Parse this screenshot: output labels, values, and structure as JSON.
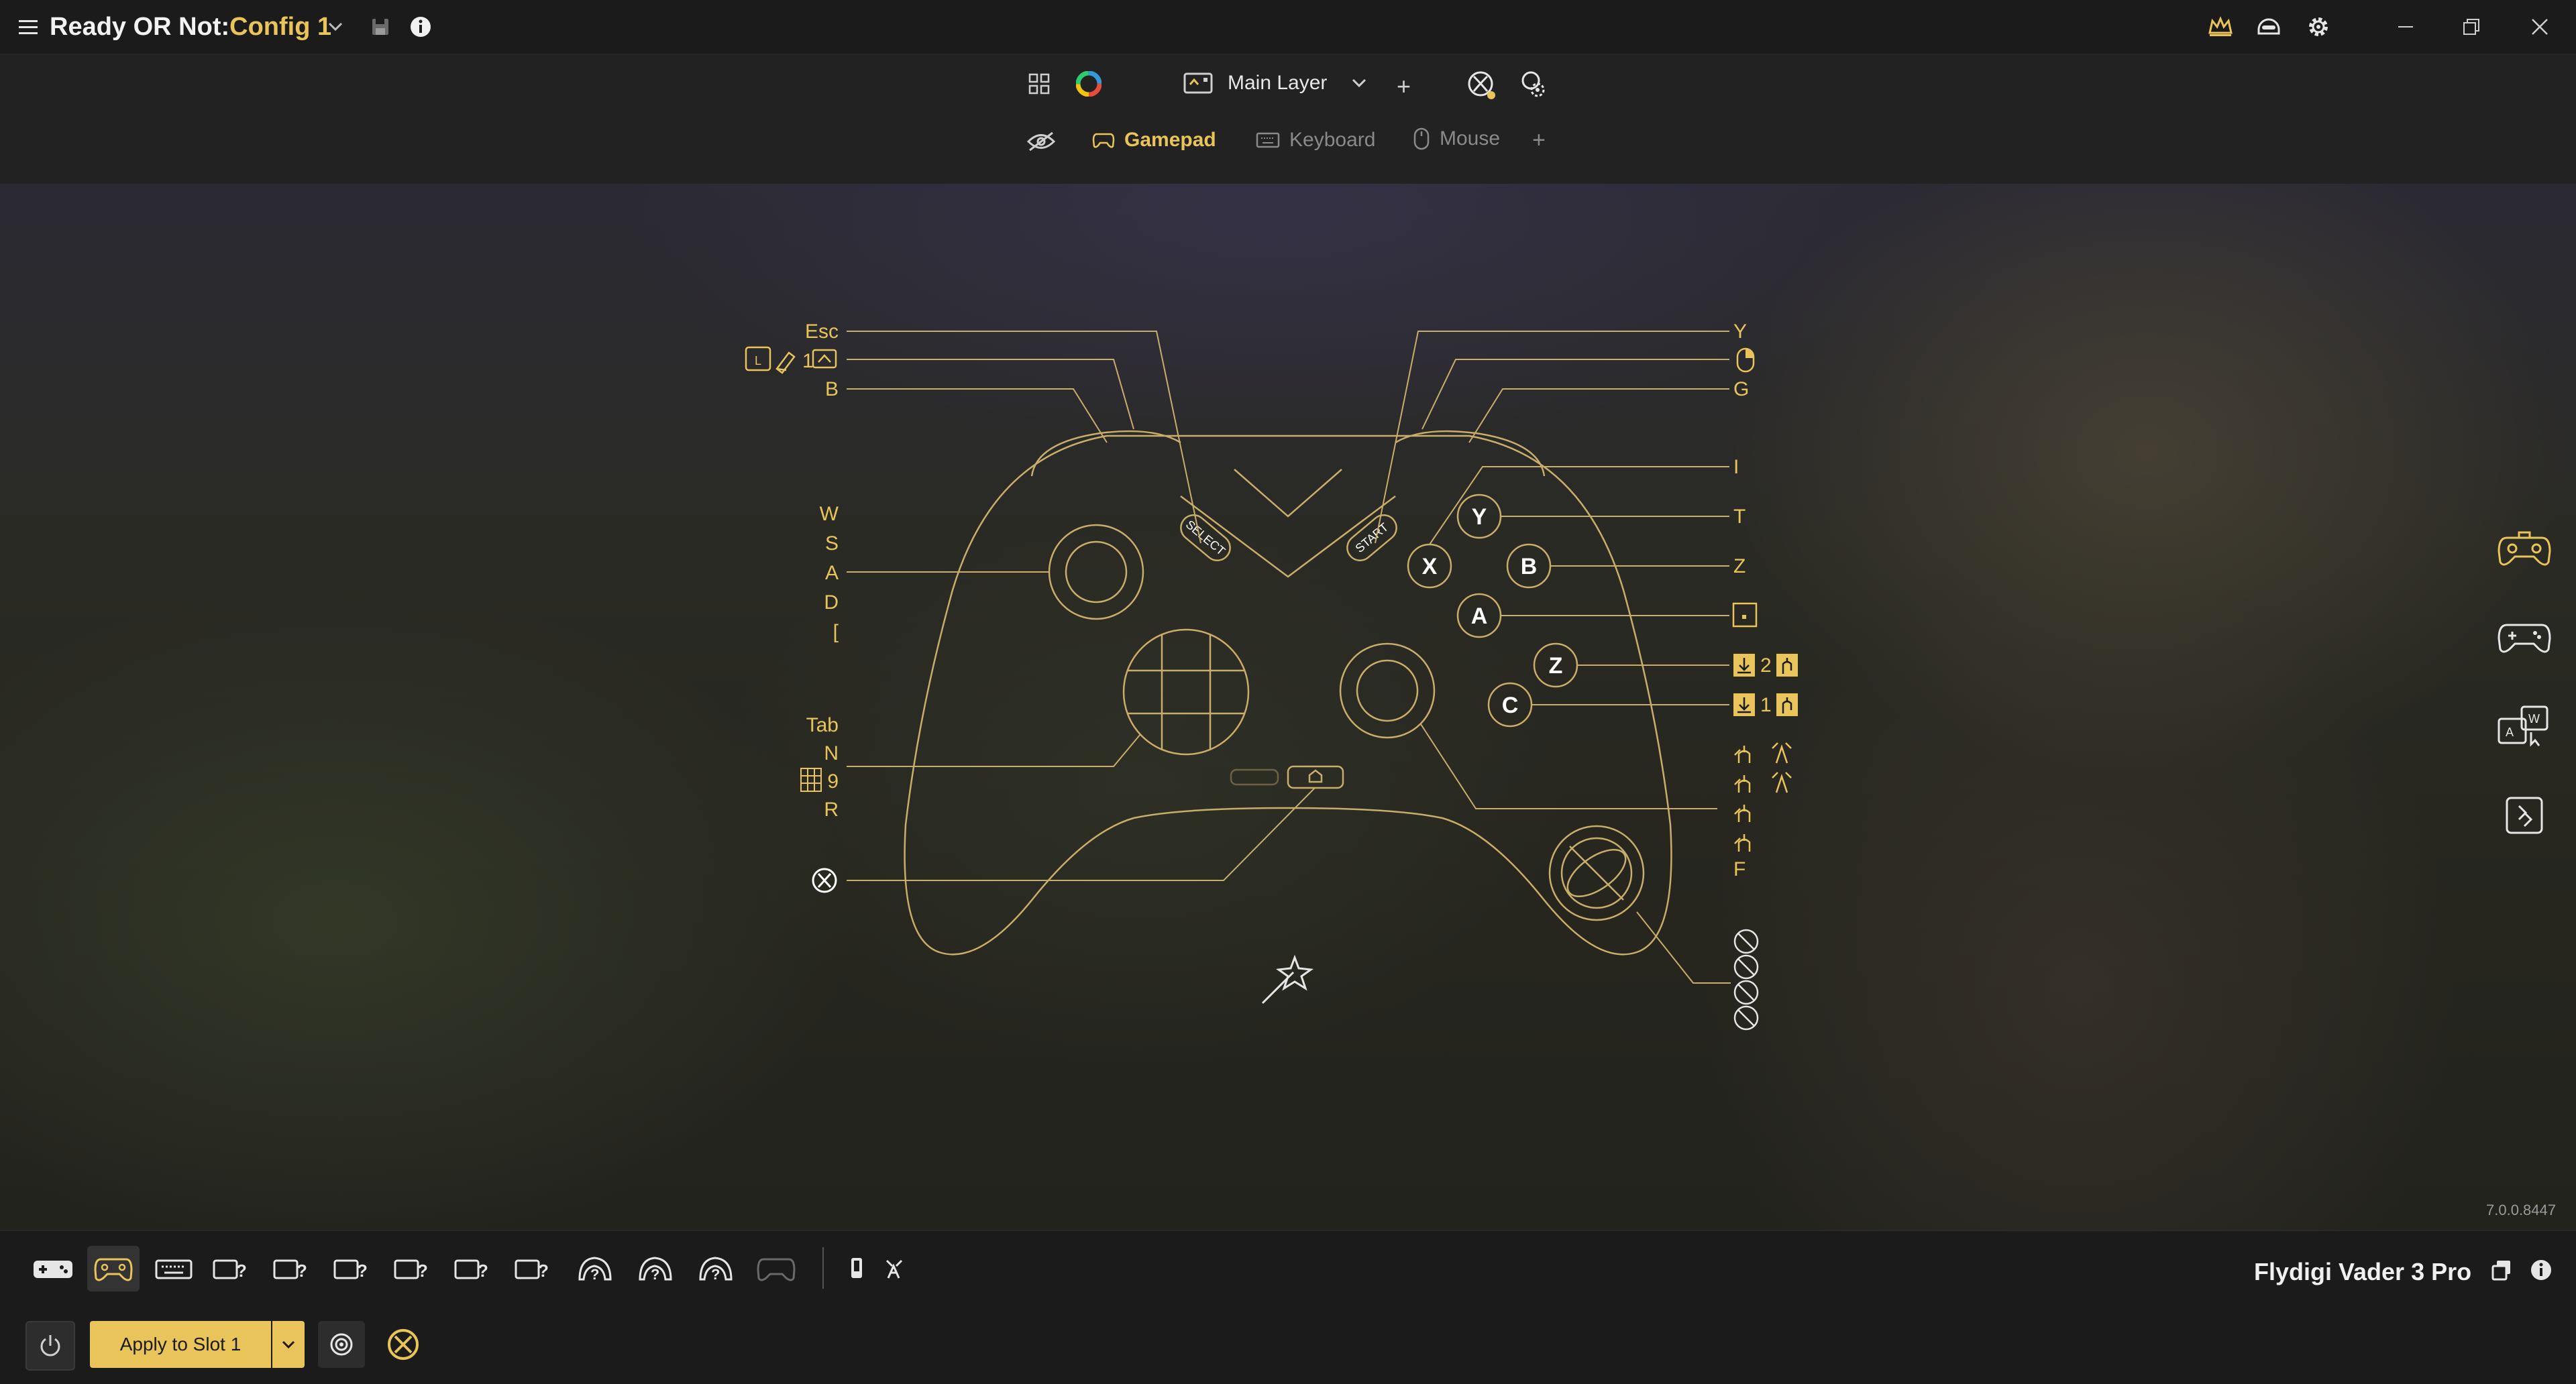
{
  "titlebar": {
    "app_name": "Ready OR Not",
    "separator": " : ",
    "config_name": "Config 1"
  },
  "toolbar": {
    "layer_name": "Main Layer",
    "add_label": "+",
    "tabs": [
      {
        "label": "Gamepad",
        "active": true
      },
      {
        "label": "Keyboard",
        "active": false
      },
      {
        "label": "Mouse",
        "active": false
      }
    ],
    "add_tab_label": "+"
  },
  "left_labels": {
    "esc": "Esc",
    "lb_layer_num": "1",
    "b_top": "B",
    "stick_w": "W",
    "stick_s": "S",
    "stick_a": "A",
    "stick_d": "D",
    "stick_bracket": "[",
    "dpad_tab": "Tab",
    "dpad_n": "N",
    "dpad_9": "9",
    "dpad_r": "R"
  },
  "right_labels": {
    "y_top": "Y",
    "g": "G",
    "i": "I",
    "t": "T",
    "z": "Z",
    "m2_num": "2",
    "m1_num": "1",
    "f": "F"
  },
  "face_buttons": {
    "y": "Y",
    "x": "X",
    "b": "B",
    "a": "A",
    "z": "Z",
    "c": "C",
    "select": "SELECT",
    "start": "START"
  },
  "version": "7.0.0.8447",
  "bottombar": {
    "device_name": "Flydigi Vader 3 Pro",
    "apply_label": "Apply to Slot 1"
  },
  "colors": {
    "accent": "#e8c45a",
    "line": "#c9ad6a",
    "background": "#1b1b1b"
  }
}
